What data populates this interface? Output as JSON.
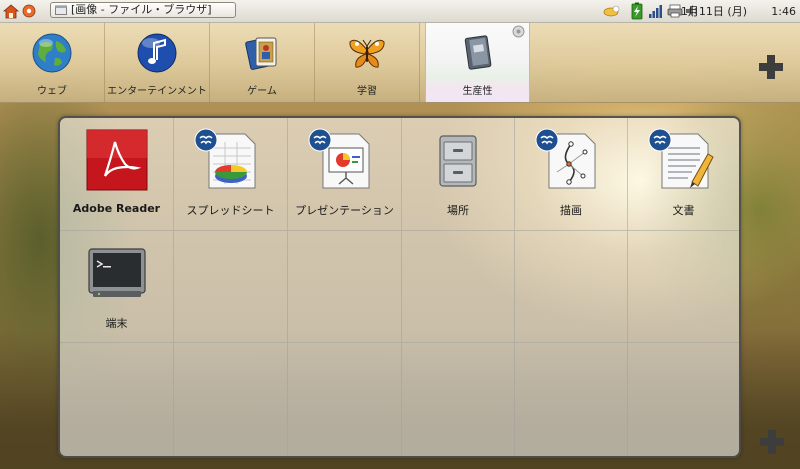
{
  "panel": {
    "window_title": "[画像 - ファイル・ブラウザ]",
    "date": "1月11日 (月)",
    "time": "1:46",
    "tray_icons": [
      "weather-icon",
      "battery-icon",
      "signal-icon",
      "printer-icon",
      "volume-icon"
    ]
  },
  "categories": [
    {
      "label": "ウェブ",
      "icon": "globe-icon",
      "active": false
    },
    {
      "label": "エンターテインメント",
      "icon": "music-note-icon",
      "active": false
    },
    {
      "label": "ゲーム",
      "icon": "playing-cards-icon",
      "active": false
    },
    {
      "label": "学習",
      "icon": "butterfly-icon",
      "active": false
    },
    {
      "label": "生産性",
      "icon": "notebook-icon",
      "active": true
    }
  ],
  "apps": [
    {
      "label": "Adobe Reader",
      "icon": "adobe-reader-icon",
      "badge": false
    },
    {
      "label": "スプレッドシート",
      "icon": "spreadsheet-icon",
      "badge": true
    },
    {
      "label": "プレゼンテーション",
      "icon": "presentation-icon",
      "badge": true
    },
    {
      "label": "場所",
      "icon": "file-cabinet-icon",
      "badge": false
    },
    {
      "label": "描画",
      "icon": "drawing-icon",
      "badge": true
    },
    {
      "label": "文書",
      "icon": "document-icon",
      "badge": true
    },
    {
      "label": "端末",
      "icon": "terminal-icon",
      "badge": false
    }
  ],
  "colors": {
    "accent_badge": "#1d4f91",
    "adobe_red": "#c4161c",
    "active_tab": "#f6f6f6"
  }
}
